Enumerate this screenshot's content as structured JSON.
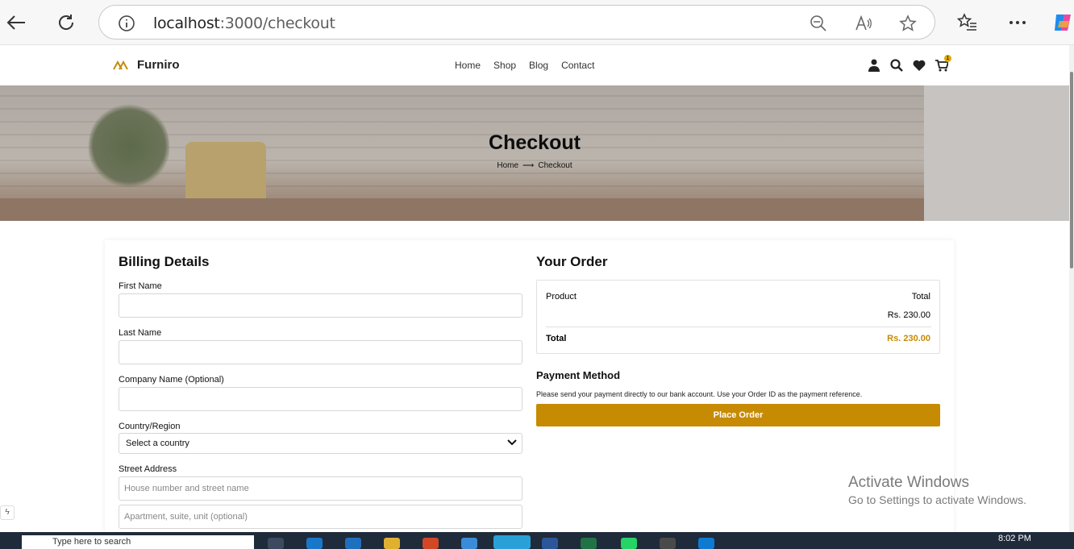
{
  "browser": {
    "url_host": "localhost",
    "url_path": ":3000/checkout"
  },
  "site": {
    "brand": "Furniro",
    "nav": [
      "Home",
      "Shop",
      "Blog",
      "Contact"
    ],
    "cart_count": "1"
  },
  "hero": {
    "title": "Checkout",
    "breadcrumb_home": "Home",
    "breadcrumb_arrow": "⟶",
    "breadcrumb_current": "Checkout"
  },
  "billing": {
    "title": "Billing Details",
    "first_name_label": "First Name",
    "last_name_label": "Last Name",
    "company_label": "Company Name (Optional)",
    "country_label": "Country/Region",
    "country_value": "Select a country",
    "street_label": "Street Address",
    "street_placeholder": "House number and street name",
    "apartment_placeholder": "Apartment, suite, unit (optional)"
  },
  "order": {
    "title": "Your Order",
    "col_product": "Product",
    "col_total": "Total",
    "line_total": "Rs. 230.00",
    "total_label": "Total",
    "total_value": "Rs. 230.00",
    "accent_color": "#c78a03"
  },
  "payment": {
    "title": "Payment Method",
    "description": "Please send your payment directly to our bank account. Use your Order ID as the payment reference.",
    "button": "Place Order"
  },
  "windows": {
    "watermark_title": "Activate Windows",
    "watermark_sub": "Go to Settings to activate Windows.",
    "search_placeholder": "Type here to search",
    "time": "8:02 PM"
  }
}
